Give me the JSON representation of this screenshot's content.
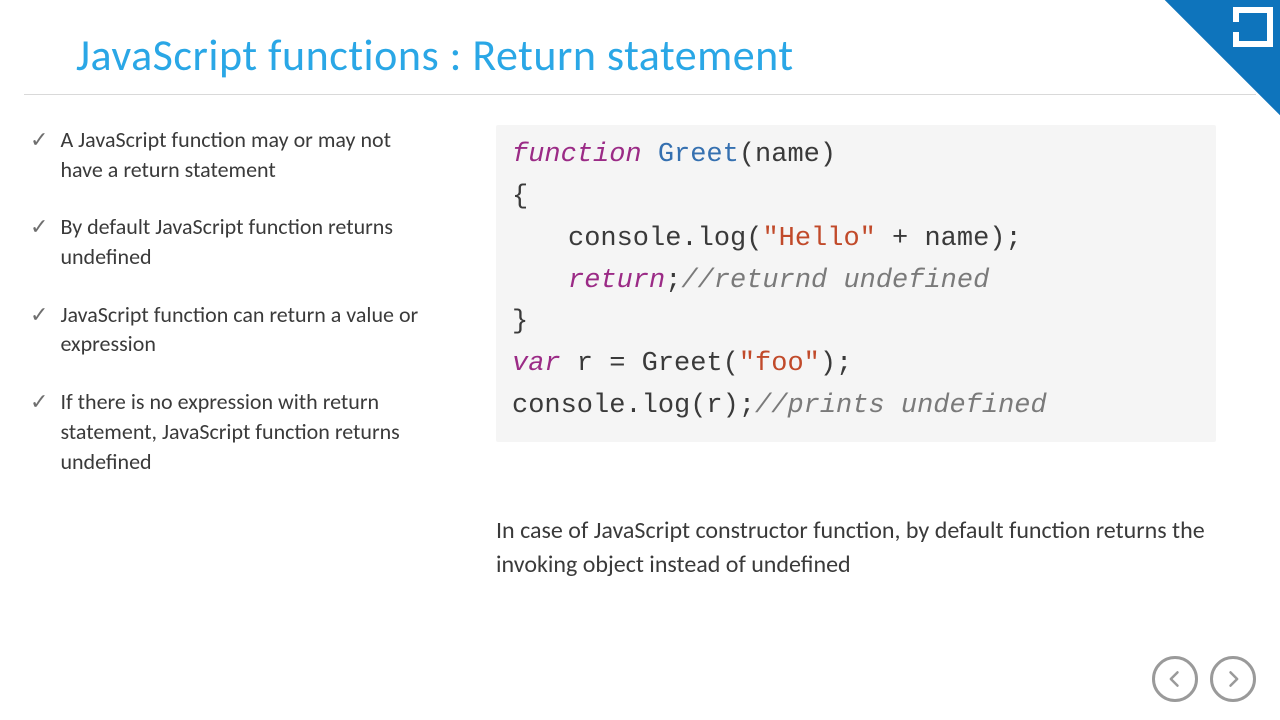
{
  "title": "JavaScript functions : Return statement",
  "bullets": [
    "A JavaScript function may or may not have a return statement",
    "By default JavaScript function returns undefined",
    "JavaScript function can return a value or expression",
    "If there  is no expression with return statement, JavaScript function returns undefined"
  ],
  "code": {
    "line1": {
      "kw": "function",
      "fn": " Greet",
      "rest": "(name)"
    },
    "line2": "{",
    "line3": {
      "pre": "console.log(",
      "str": "\"Hello\"",
      "post": " + name);"
    },
    "line4": {
      "kw": "return",
      "post": ";",
      "cmt": "//returnd undefined"
    },
    "line5": "}",
    "line6": {
      "kw": "var",
      "mid": " r = Greet(",
      "str": "\"foo\"",
      "post": ");"
    },
    "line7": {
      "pre": "console.log(r);",
      "cmt": "//prints undefined"
    }
  },
  "note": "In case of JavaScript constructor function, by default function returns the invoking object instead of undefined",
  "icons": {
    "check": "✓",
    "prev": "prev-arrow",
    "next": "next-arrow",
    "logo": "infragistics-logo"
  }
}
